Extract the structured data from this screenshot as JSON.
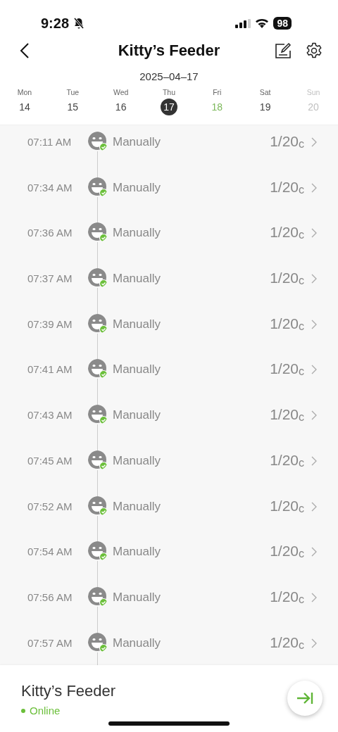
{
  "status_bar": {
    "time": "9:28",
    "silent": true,
    "battery": "98"
  },
  "header": {
    "title": "Kitty’s Feeder"
  },
  "date": "2025–04–17",
  "week": [
    {
      "day": "Mon",
      "date": "14",
      "selected": false,
      "today": false,
      "disabled": false
    },
    {
      "day": "Tue",
      "date": "15",
      "selected": false,
      "today": false,
      "disabled": false
    },
    {
      "day": "Wed",
      "date": "16",
      "selected": false,
      "today": false,
      "disabled": false
    },
    {
      "day": "Thu",
      "date": "17",
      "selected": true,
      "today": false,
      "disabled": false
    },
    {
      "day": "Fri",
      "date": "18",
      "selected": false,
      "today": true,
      "disabled": false
    },
    {
      "day": "Sat",
      "date": "19",
      "selected": false,
      "today": false,
      "disabled": false
    },
    {
      "day": "Sun",
      "date": "20",
      "selected": false,
      "today": false,
      "disabled": true
    }
  ],
  "feedings": [
    {
      "time": "07:11 AM",
      "method": "Manually",
      "amount": "1/20",
      "unit": "c",
      "done": true
    },
    {
      "time": "07:34 AM",
      "method": "Manually",
      "amount": "1/20",
      "unit": "c",
      "done": true
    },
    {
      "time": "07:36 AM",
      "method": "Manually",
      "amount": "1/20",
      "unit": "c",
      "done": true
    },
    {
      "time": "07:37 AM",
      "method": "Manually",
      "amount": "1/20",
      "unit": "c",
      "done": true
    },
    {
      "time": "07:39 AM",
      "method": "Manually",
      "amount": "1/20",
      "unit": "c",
      "done": true
    },
    {
      "time": "07:41 AM",
      "method": "Manually",
      "amount": "1/20",
      "unit": "c",
      "done": true
    },
    {
      "time": "07:43 AM",
      "method": "Manually",
      "amount": "1/20",
      "unit": "c",
      "done": true
    },
    {
      "time": "07:45 AM",
      "method": "Manually",
      "amount": "1/20",
      "unit": "c",
      "done": true
    },
    {
      "time": "07:52 AM",
      "method": "Manually",
      "amount": "1/20",
      "unit": "c",
      "done": true
    },
    {
      "time": "07:54 AM",
      "method": "Manually",
      "amount": "1/20",
      "unit": "c",
      "done": true
    },
    {
      "time": "07:56 AM",
      "method": "Manually",
      "amount": "1/20",
      "unit": "c",
      "done": true
    },
    {
      "time": "07:57 AM",
      "method": "Manually",
      "amount": "1/20",
      "unit": "c",
      "done": true
    }
  ],
  "footer": {
    "device": "Kitty’s Feeder",
    "status": "Online",
    "online": true
  }
}
